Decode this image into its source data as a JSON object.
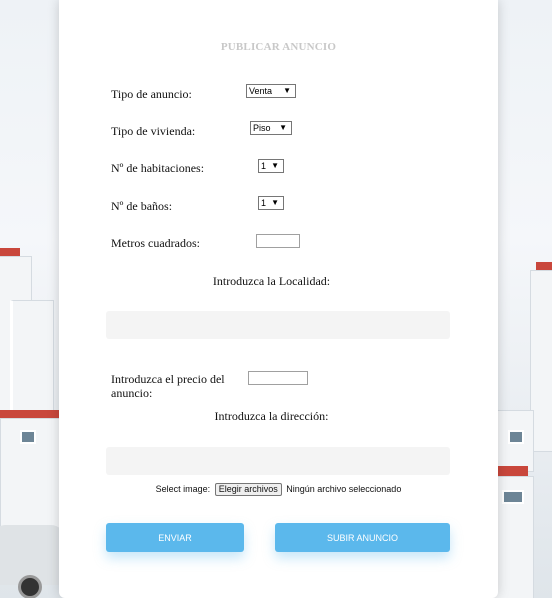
{
  "form": {
    "title": "PUBLICAR ANUNCIO",
    "tipo_anuncio": {
      "label": "Tipo de anuncio:",
      "value": "Venta"
    },
    "tipo_vivienda": {
      "label": "Tipo de vivienda:",
      "value": "Piso"
    },
    "habitaciones": {
      "label": "Nº de habitaciones:",
      "value": "1"
    },
    "banos": {
      "label": "Nº de baños:",
      "value": "1"
    },
    "metros": {
      "label": "Metros cuadrados:",
      "value": ""
    },
    "localidad": {
      "label": "Introduzca la Localidad:",
      "value": ""
    },
    "precio": {
      "label": "Introduzca el precio del anuncio:",
      "value": ""
    },
    "direccion": {
      "label": "Introduzca la dirección:",
      "value": ""
    },
    "image": {
      "label": "Select image:",
      "button": "Elegir archivos",
      "status": "Ningún archivo seleccionado"
    },
    "enviar_label": "ENVIAR",
    "subir_label": "SUBIR ANUNCIO"
  },
  "colors": {
    "accent": "#5bb8ec",
    "title": "#c8c8c8"
  },
  "icons": {
    "select_arrow": "dropdown-arrow-icon"
  }
}
